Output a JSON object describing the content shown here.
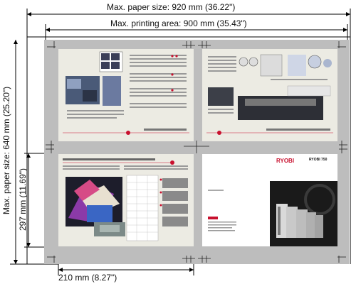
{
  "dimensions": {
    "max_paper_width": "Max. paper size: 920 mm (36.22\")",
    "max_printing_width": "Max. printing area:  900 mm (35.43\")",
    "max_paper_height": "Max. paper size:  640 mm (25.20\")",
    "page_height": "297 mm (11.69\")",
    "page_width": "210 mm (8.27\")"
  },
  "brochure": {
    "brand": "RYOBI",
    "model": "RYOBI 750"
  },
  "colors": {
    "sheet": "#bdbdbd",
    "page": "#ecebe3",
    "accent": "#c8102e",
    "dimension_line": "#000000"
  }
}
